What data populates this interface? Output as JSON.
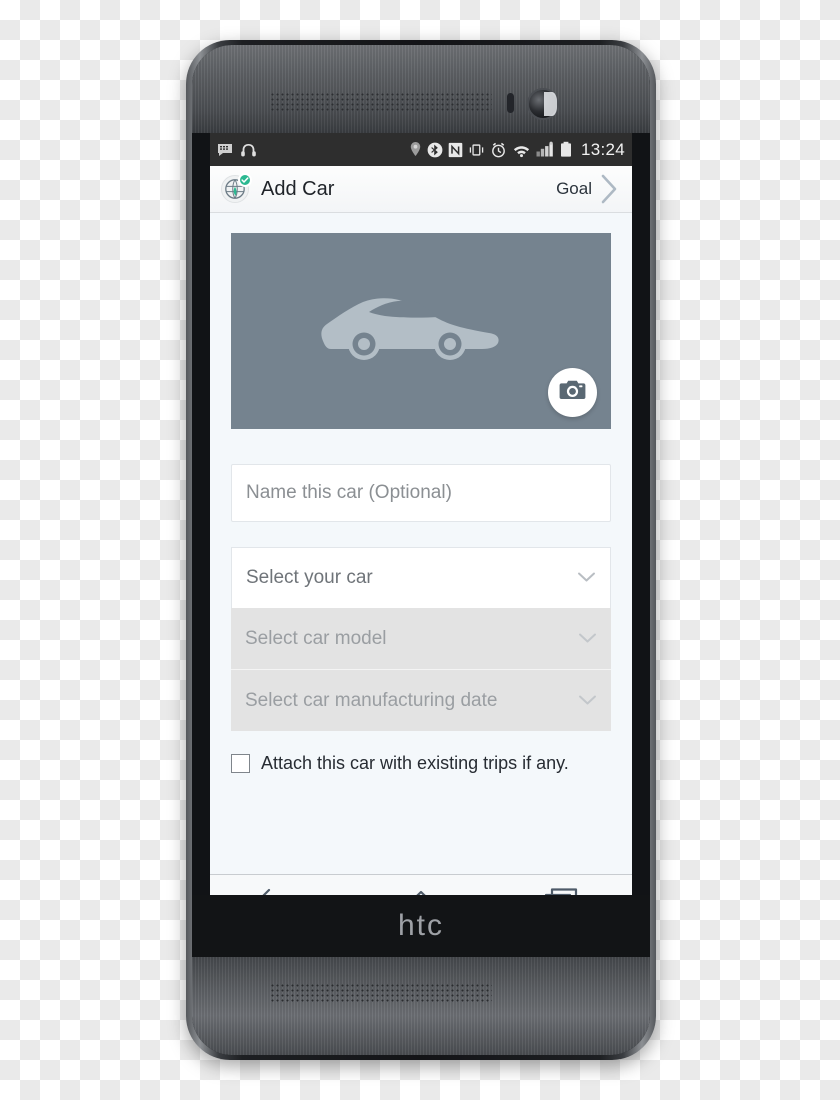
{
  "device": {
    "brand_logo": "htc",
    "speaker_top": "earpiece-speaker-grille",
    "speaker_bottom": "bottom-speaker-grille"
  },
  "status_bar": {
    "left_icons": [
      {
        "name": "message-icon",
        "glyph": "message"
      },
      {
        "name": "headphones-icon",
        "glyph": "headphones"
      }
    ],
    "right_icons": [
      {
        "name": "location-pin-icon",
        "glyph": "pin"
      },
      {
        "name": "bluetooth-icon",
        "glyph": "bluetooth"
      },
      {
        "name": "nfc-icon",
        "glyph": "nfc"
      },
      {
        "name": "vibrate-icon",
        "glyph": "vibrate"
      },
      {
        "name": "alarm-clock-icon",
        "glyph": "alarm"
      },
      {
        "name": "wifi-icon",
        "glyph": "wifi"
      },
      {
        "name": "signal-bars-icon",
        "glyph": "signal"
      },
      {
        "name": "battery-icon",
        "glyph": "battery"
      }
    ],
    "time": "13:24",
    "background": "#2e2e2e"
  },
  "app_bar": {
    "logo": "eco-globe-leaf-icon",
    "badge": "check-badge",
    "title": "Add Car",
    "action_label": "Goal",
    "action_chevron": "chevron-right-icon",
    "accent": "#2bb891"
  },
  "main": {
    "photo": {
      "placeholder_icon": "car-silhouette-icon",
      "background": "#75838f",
      "car_color": "#b3bec6",
      "camera_button": "camera-icon"
    },
    "name_field": {
      "placeholder": "Name this car (Optional)",
      "value": ""
    },
    "selects": [
      {
        "label": "Select your car",
        "enabled": true,
        "chevron": "chevron-down-icon"
      },
      {
        "label": "Select car model",
        "enabled": false,
        "chevron": "chevron-down-icon"
      },
      {
        "label": "Select car manufacturing date",
        "enabled": false,
        "chevron": "chevron-down-icon"
      }
    ],
    "checkbox": {
      "label": "Attach this car with existing trips if any.",
      "checked": false
    }
  },
  "nav_bar": {
    "buttons": [
      {
        "name": "back-button",
        "icon": "back-arrow-icon"
      },
      {
        "name": "home-button",
        "icon": "home-icon"
      },
      {
        "name": "recents-button",
        "icon": "recents-icon"
      }
    ]
  }
}
